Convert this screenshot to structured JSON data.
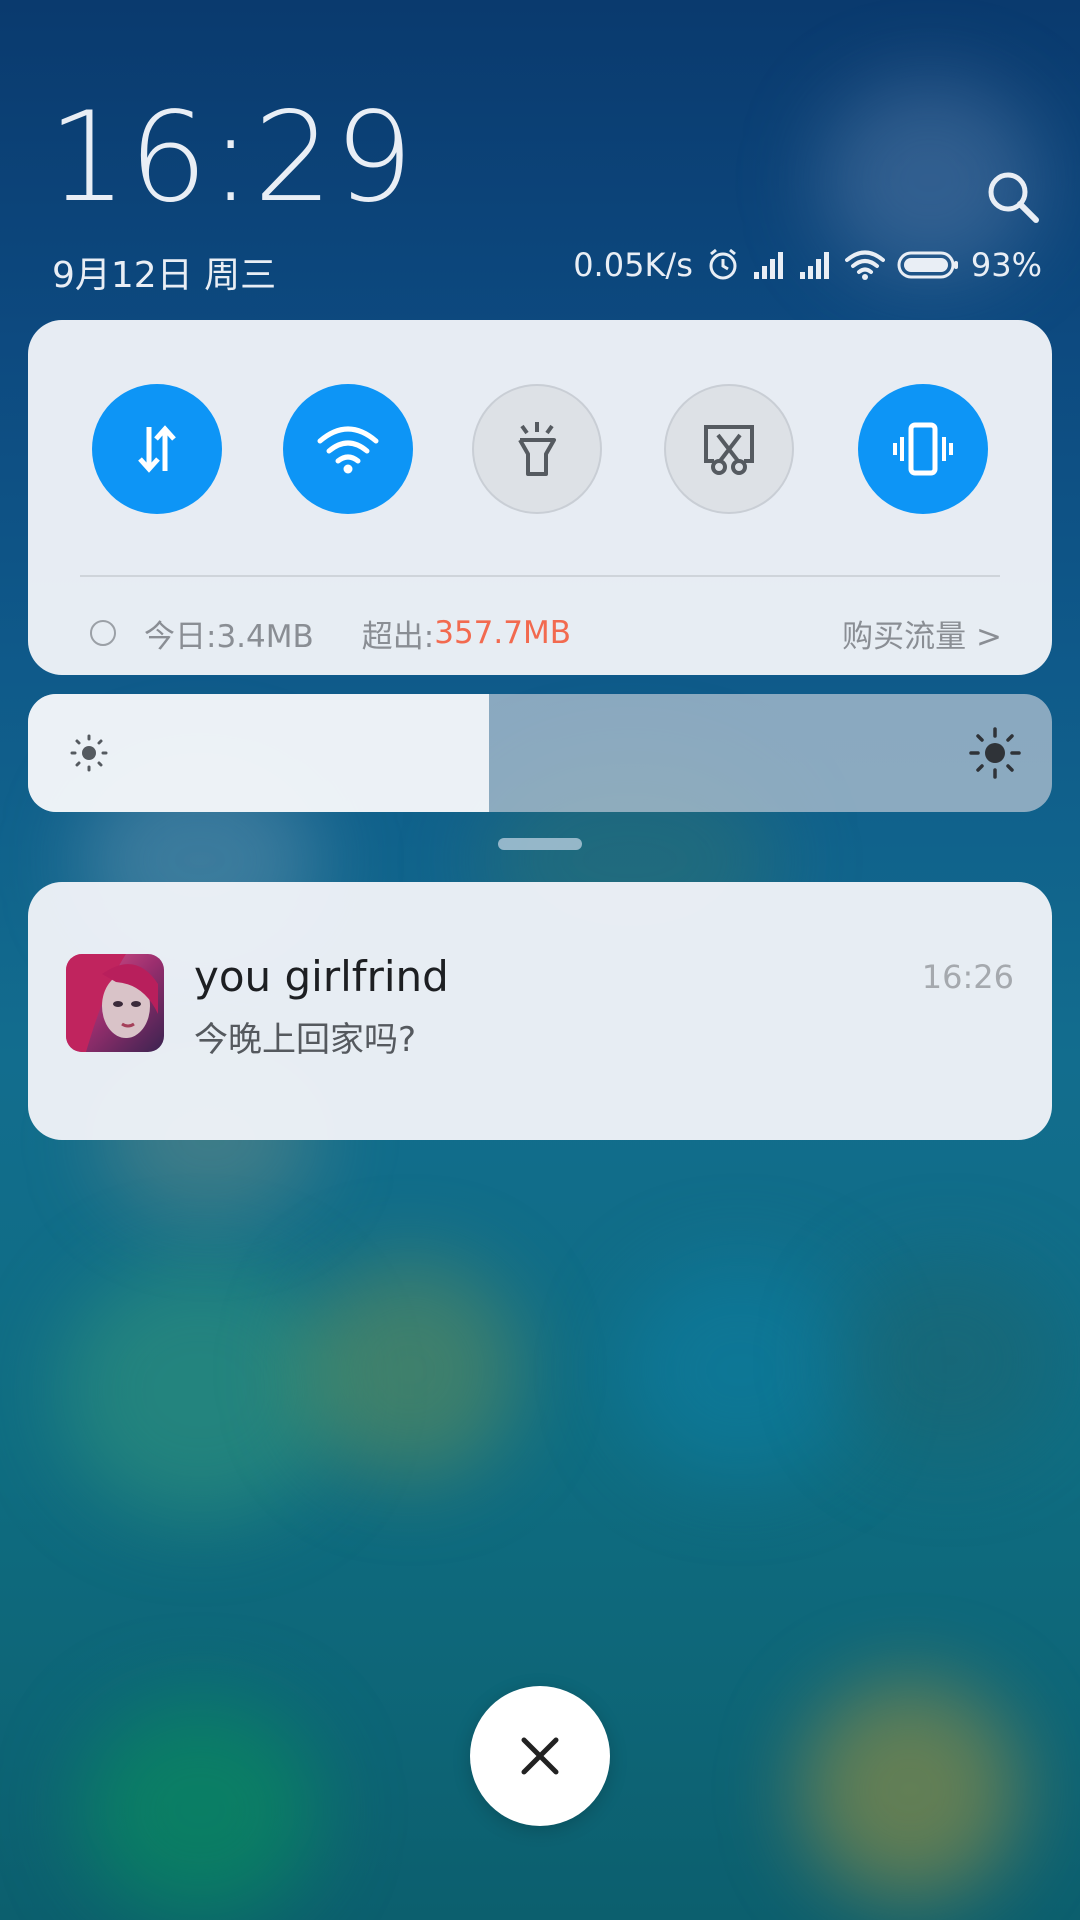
{
  "lockscreen": {
    "time": "16:29",
    "date": "9月12日 周三"
  },
  "status_bar": {
    "net_speed": "0.05K/s",
    "battery_percent": "93%",
    "battery_level": 0.93,
    "icons": [
      "alarm-icon",
      "signal-icon",
      "signal-icon",
      "wifi-icon",
      "battery-icon"
    ]
  },
  "quick_toggles": [
    {
      "name": "mobile-data",
      "icon": "data-transfer-icon",
      "state": "on"
    },
    {
      "name": "wifi",
      "icon": "wifi-icon",
      "state": "on"
    },
    {
      "name": "flashlight",
      "icon": "flashlight-icon",
      "state": "off"
    },
    {
      "name": "screenshot",
      "icon": "screenshot-scissors-icon",
      "state": "off"
    },
    {
      "name": "vibrate",
      "icon": "vibrate-icon",
      "state": "on"
    }
  ],
  "data_usage": {
    "today_label": "今日:3.4MB",
    "over_label": "超出:",
    "over_value": "357.7MB",
    "buy_label": "购买流量 >"
  },
  "brightness": {
    "level": 0.45
  },
  "notification": {
    "title": "you  girlfrind",
    "message": "今晚上回家吗?",
    "time": "16:26",
    "avatar": "avatar-girl-pink-hair"
  },
  "colors": {
    "accent": "#0d95f6",
    "highlight": "#f26a4f",
    "card_bg": "#eef2f7"
  }
}
